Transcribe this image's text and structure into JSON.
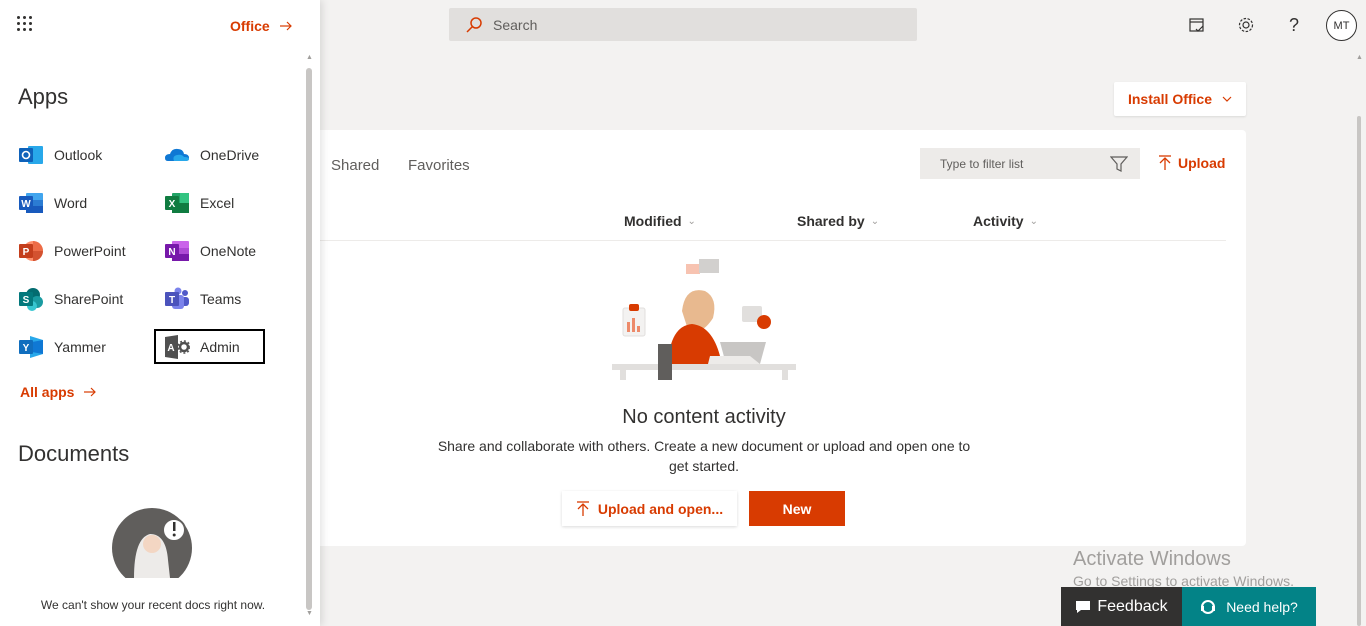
{
  "topbar": {
    "search_placeholder": "Search",
    "user_initials": "MT"
  },
  "install_office": "Install Office",
  "tabs": [
    "Shared",
    "Favorites"
  ],
  "filter_placeholder": "Type to filter list",
  "upload_label": "Upload",
  "columns": [
    "Modified",
    "Shared by",
    "Activity"
  ],
  "empty_state": {
    "title": "No content activity",
    "description": "Share and collaborate with others. Create a new document or upload and open one to get started.",
    "upload_open": "Upload and open...",
    "new": "New"
  },
  "activate": {
    "title": "Activate Windows",
    "subtitle": "Go to Settings to activate Windows."
  },
  "feedback_label": "Feedback",
  "needhelp_label": "Need help?",
  "panel": {
    "office_link": "Office",
    "apps_title": "Apps",
    "apps": [
      {
        "label": "Outlook",
        "icon": "outlook-icon"
      },
      {
        "label": "OneDrive",
        "icon": "onedrive-icon"
      },
      {
        "label": "Word",
        "icon": "word-icon"
      },
      {
        "label": "Excel",
        "icon": "excel-icon"
      },
      {
        "label": "PowerPoint",
        "icon": "powerpoint-icon"
      },
      {
        "label": "OneNote",
        "icon": "onenote-icon"
      },
      {
        "label": "SharePoint",
        "icon": "sharepoint-icon"
      },
      {
        "label": "Teams",
        "icon": "teams-icon"
      },
      {
        "label": "Yammer",
        "icon": "yammer-icon"
      },
      {
        "label": "Admin",
        "icon": "admin-icon"
      }
    ],
    "all_apps": "All apps",
    "documents_title": "Documents",
    "docs_message": "We can't show your recent docs right now."
  },
  "colors": {
    "accent": "#d83b01",
    "help": "#038387"
  }
}
